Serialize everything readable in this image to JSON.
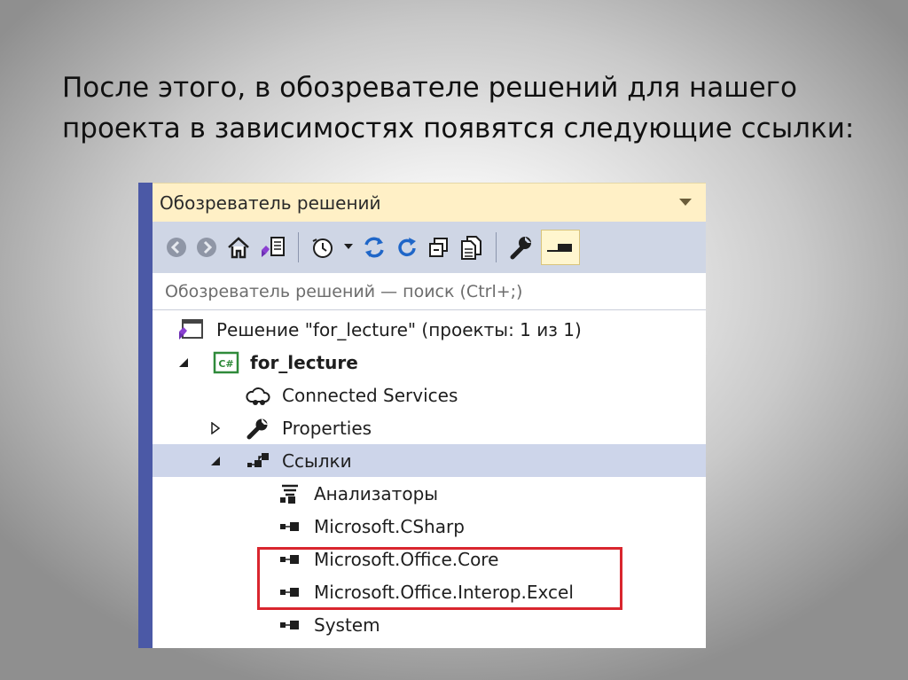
{
  "slide": {
    "text_line1": "После этого, в обозревателе решений для нашего",
    "text_line2": "проекта в зависимостях появятся следующие ссылки:"
  },
  "panel": {
    "title": "Обозреватель решений",
    "search_placeholder": "Обозреватель решений — поиск (Ctrl+;)",
    "toolbar_icons": [
      "back-icon",
      "forward-icon",
      "home-icon",
      "switch-views-icon",
      "history-icon",
      "dropdown-icon",
      "sync-icon",
      "refresh-icon",
      "collapse-all-icon",
      "show-all-files-icon",
      "properties-wrench-icon",
      "preview-pin-icon"
    ]
  },
  "tree": {
    "solution": "Решение \"for_lecture\" (проекты: 1 из 1)",
    "project": "for_lecture",
    "project_badge": "C#",
    "connected_services": "Connected Services",
    "properties": "Properties",
    "references": "Ссылки",
    "items": [
      {
        "label": "Анализаторы",
        "icon": "analyzer-icon"
      },
      {
        "label": "Microsoft.CSharp",
        "icon": "reference-icon"
      },
      {
        "label": "Microsoft.Office.Core",
        "icon": "reference-icon"
      },
      {
        "label": "Microsoft.Office.Interop.Excel",
        "icon": "reference-icon"
      },
      {
        "label": "System",
        "icon": "reference-icon"
      }
    ]
  },
  "colors": {
    "accent_border": "#4b59a6",
    "title_bar": "#fff0c6",
    "toolbar": "#cfd6e5",
    "selected_row": "#cdd5ea",
    "highlight": "#d9262e"
  }
}
